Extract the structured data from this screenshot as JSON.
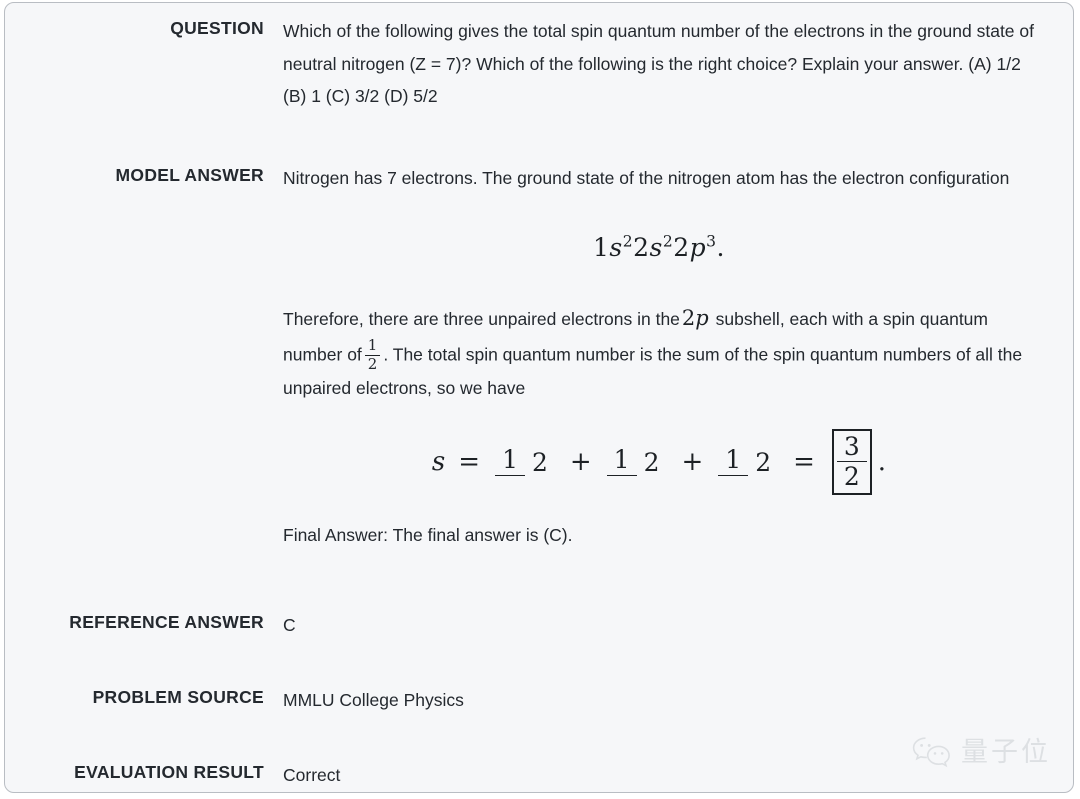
{
  "card": {
    "background_color": "#f6f7f9",
    "border_color": "#b9bdc3"
  },
  "rows": {
    "question": {
      "label": "QUESTION",
      "text": "Which of the following gives the total spin quantum number of the electrons in the ground state of neutral nitrogen (Z = 7)? Which of the following is the right choice? Explain your answer. (A) 1/2 (B) 1 (C) 3/2 (D) 5/2"
    },
    "model_answer": {
      "label": "MODEL ANSWER",
      "paragraph1": "Nitrogen has 7 electrons. The ground state of the nitrogen atom has the electron configuration",
      "display_math1": "1s²2s²2p³.",
      "para2_part1": "Therefore, there are three unpaired electrons in the",
      "para2_math1": "2p",
      "para2_part2": "subshell, each with a spin quantum number of",
      "para2_frac_num": "1",
      "para2_frac_den": "2",
      "para2_part3": ". The total spin quantum number is the sum of the spin quantum numbers of all the unpaired electrons, so we have",
      "display_math2": {
        "variable": "s",
        "equals": "=",
        "term1_num": "1",
        "term1_den": "2",
        "plus1": "+",
        "term2_num": "1",
        "term2_den": "2",
        "plus2": "+",
        "term3_num": "1",
        "term3_den": "2",
        "equals2": "=",
        "boxed_num": "3",
        "boxed_den": "2",
        "period": "."
      },
      "final_line": "Final Answer: The final answer is (C)."
    },
    "reference_answer": {
      "label": "REFERENCE ANSWER",
      "value": "C"
    },
    "problem_source": {
      "label": "PROBLEM SOURCE",
      "value": "MMLU College Physics"
    },
    "evaluation_result": {
      "label": "EVALUATION RESULT",
      "value": "Correct"
    }
  },
  "watermark": {
    "icon": "wechat-icon",
    "text": "量子位",
    "color": "#c6cace"
  }
}
